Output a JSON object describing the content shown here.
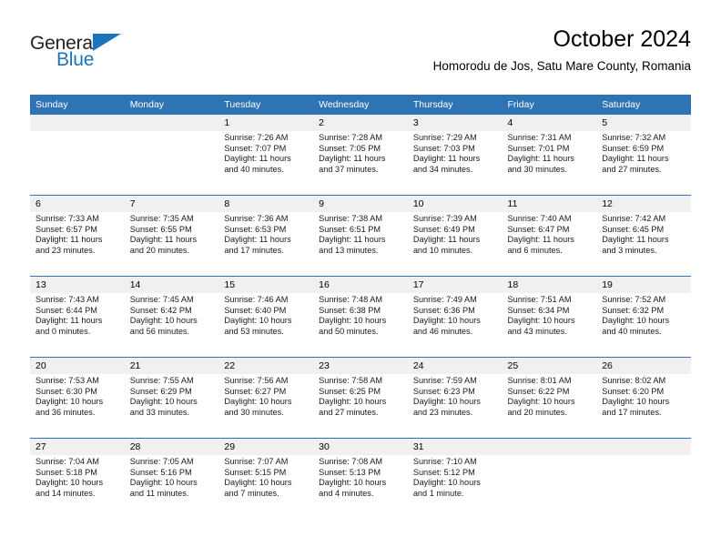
{
  "brand": {
    "name_part1": "General",
    "name_part2": "Blue"
  },
  "header": {
    "title": "October 2024",
    "subtitle": "Homorodu de Jos, Satu Mare County, Romania"
  },
  "colors": {
    "header_blue": "#2e74b5",
    "logo_blue": "#1b75bb",
    "daynum_band": "#f0f0f0"
  },
  "weekday_headers": [
    "Sunday",
    "Monday",
    "Tuesday",
    "Wednesday",
    "Thursday",
    "Friday",
    "Saturday"
  ],
  "weeks": [
    [
      {
        "day": "",
        "lines": []
      },
      {
        "day": "",
        "lines": []
      },
      {
        "day": "1",
        "lines": [
          "Sunrise: 7:26 AM",
          "Sunset: 7:07 PM",
          "Daylight: 11 hours",
          "and 40 minutes."
        ]
      },
      {
        "day": "2",
        "lines": [
          "Sunrise: 7:28 AM",
          "Sunset: 7:05 PM",
          "Daylight: 11 hours",
          "and 37 minutes."
        ]
      },
      {
        "day": "3",
        "lines": [
          "Sunrise: 7:29 AM",
          "Sunset: 7:03 PM",
          "Daylight: 11 hours",
          "and 34 minutes."
        ]
      },
      {
        "day": "4",
        "lines": [
          "Sunrise: 7:31 AM",
          "Sunset: 7:01 PM",
          "Daylight: 11 hours",
          "and 30 minutes."
        ]
      },
      {
        "day": "5",
        "lines": [
          "Sunrise: 7:32 AM",
          "Sunset: 6:59 PM",
          "Daylight: 11 hours",
          "and 27 minutes."
        ]
      }
    ],
    [
      {
        "day": "6",
        "lines": [
          "Sunrise: 7:33 AM",
          "Sunset: 6:57 PM",
          "Daylight: 11 hours",
          "and 23 minutes."
        ]
      },
      {
        "day": "7",
        "lines": [
          "Sunrise: 7:35 AM",
          "Sunset: 6:55 PM",
          "Daylight: 11 hours",
          "and 20 minutes."
        ]
      },
      {
        "day": "8",
        "lines": [
          "Sunrise: 7:36 AM",
          "Sunset: 6:53 PM",
          "Daylight: 11 hours",
          "and 17 minutes."
        ]
      },
      {
        "day": "9",
        "lines": [
          "Sunrise: 7:38 AM",
          "Sunset: 6:51 PM",
          "Daylight: 11 hours",
          "and 13 minutes."
        ]
      },
      {
        "day": "10",
        "lines": [
          "Sunrise: 7:39 AM",
          "Sunset: 6:49 PM",
          "Daylight: 11 hours",
          "and 10 minutes."
        ]
      },
      {
        "day": "11",
        "lines": [
          "Sunrise: 7:40 AM",
          "Sunset: 6:47 PM",
          "Daylight: 11 hours",
          "and 6 minutes."
        ]
      },
      {
        "day": "12",
        "lines": [
          "Sunrise: 7:42 AM",
          "Sunset: 6:45 PM",
          "Daylight: 11 hours",
          "and 3 minutes."
        ]
      }
    ],
    [
      {
        "day": "13",
        "lines": [
          "Sunrise: 7:43 AM",
          "Sunset: 6:44 PM",
          "Daylight: 11 hours",
          "and 0 minutes."
        ]
      },
      {
        "day": "14",
        "lines": [
          "Sunrise: 7:45 AM",
          "Sunset: 6:42 PM",
          "Daylight: 10 hours",
          "and 56 minutes."
        ]
      },
      {
        "day": "15",
        "lines": [
          "Sunrise: 7:46 AM",
          "Sunset: 6:40 PM",
          "Daylight: 10 hours",
          "and 53 minutes."
        ]
      },
      {
        "day": "16",
        "lines": [
          "Sunrise: 7:48 AM",
          "Sunset: 6:38 PM",
          "Daylight: 10 hours",
          "and 50 minutes."
        ]
      },
      {
        "day": "17",
        "lines": [
          "Sunrise: 7:49 AM",
          "Sunset: 6:36 PM",
          "Daylight: 10 hours",
          "and 46 minutes."
        ]
      },
      {
        "day": "18",
        "lines": [
          "Sunrise: 7:51 AM",
          "Sunset: 6:34 PM",
          "Daylight: 10 hours",
          "and 43 minutes."
        ]
      },
      {
        "day": "19",
        "lines": [
          "Sunrise: 7:52 AM",
          "Sunset: 6:32 PM",
          "Daylight: 10 hours",
          "and 40 minutes."
        ]
      }
    ],
    [
      {
        "day": "20",
        "lines": [
          "Sunrise: 7:53 AM",
          "Sunset: 6:30 PM",
          "Daylight: 10 hours",
          "and 36 minutes."
        ]
      },
      {
        "day": "21",
        "lines": [
          "Sunrise: 7:55 AM",
          "Sunset: 6:29 PM",
          "Daylight: 10 hours",
          "and 33 minutes."
        ]
      },
      {
        "day": "22",
        "lines": [
          "Sunrise: 7:56 AM",
          "Sunset: 6:27 PM",
          "Daylight: 10 hours",
          "and 30 minutes."
        ]
      },
      {
        "day": "23",
        "lines": [
          "Sunrise: 7:58 AM",
          "Sunset: 6:25 PM",
          "Daylight: 10 hours",
          "and 27 minutes."
        ]
      },
      {
        "day": "24",
        "lines": [
          "Sunrise: 7:59 AM",
          "Sunset: 6:23 PM",
          "Daylight: 10 hours",
          "and 23 minutes."
        ]
      },
      {
        "day": "25",
        "lines": [
          "Sunrise: 8:01 AM",
          "Sunset: 6:22 PM",
          "Daylight: 10 hours",
          "and 20 minutes."
        ]
      },
      {
        "day": "26",
        "lines": [
          "Sunrise: 8:02 AM",
          "Sunset: 6:20 PM",
          "Daylight: 10 hours",
          "and 17 minutes."
        ]
      }
    ],
    [
      {
        "day": "27",
        "lines": [
          "Sunrise: 7:04 AM",
          "Sunset: 5:18 PM",
          "Daylight: 10 hours",
          "and 14 minutes."
        ]
      },
      {
        "day": "28",
        "lines": [
          "Sunrise: 7:05 AM",
          "Sunset: 5:16 PM",
          "Daylight: 10 hours",
          "and 11 minutes."
        ]
      },
      {
        "day": "29",
        "lines": [
          "Sunrise: 7:07 AM",
          "Sunset: 5:15 PM",
          "Daylight: 10 hours",
          "and 7 minutes."
        ]
      },
      {
        "day": "30",
        "lines": [
          "Sunrise: 7:08 AM",
          "Sunset: 5:13 PM",
          "Daylight: 10 hours",
          "and 4 minutes."
        ]
      },
      {
        "day": "31",
        "lines": [
          "Sunrise: 7:10 AM",
          "Sunset: 5:12 PM",
          "Daylight: 10 hours",
          "and 1 minute."
        ]
      },
      {
        "day": "",
        "lines": []
      },
      {
        "day": "",
        "lines": []
      }
    ]
  ]
}
